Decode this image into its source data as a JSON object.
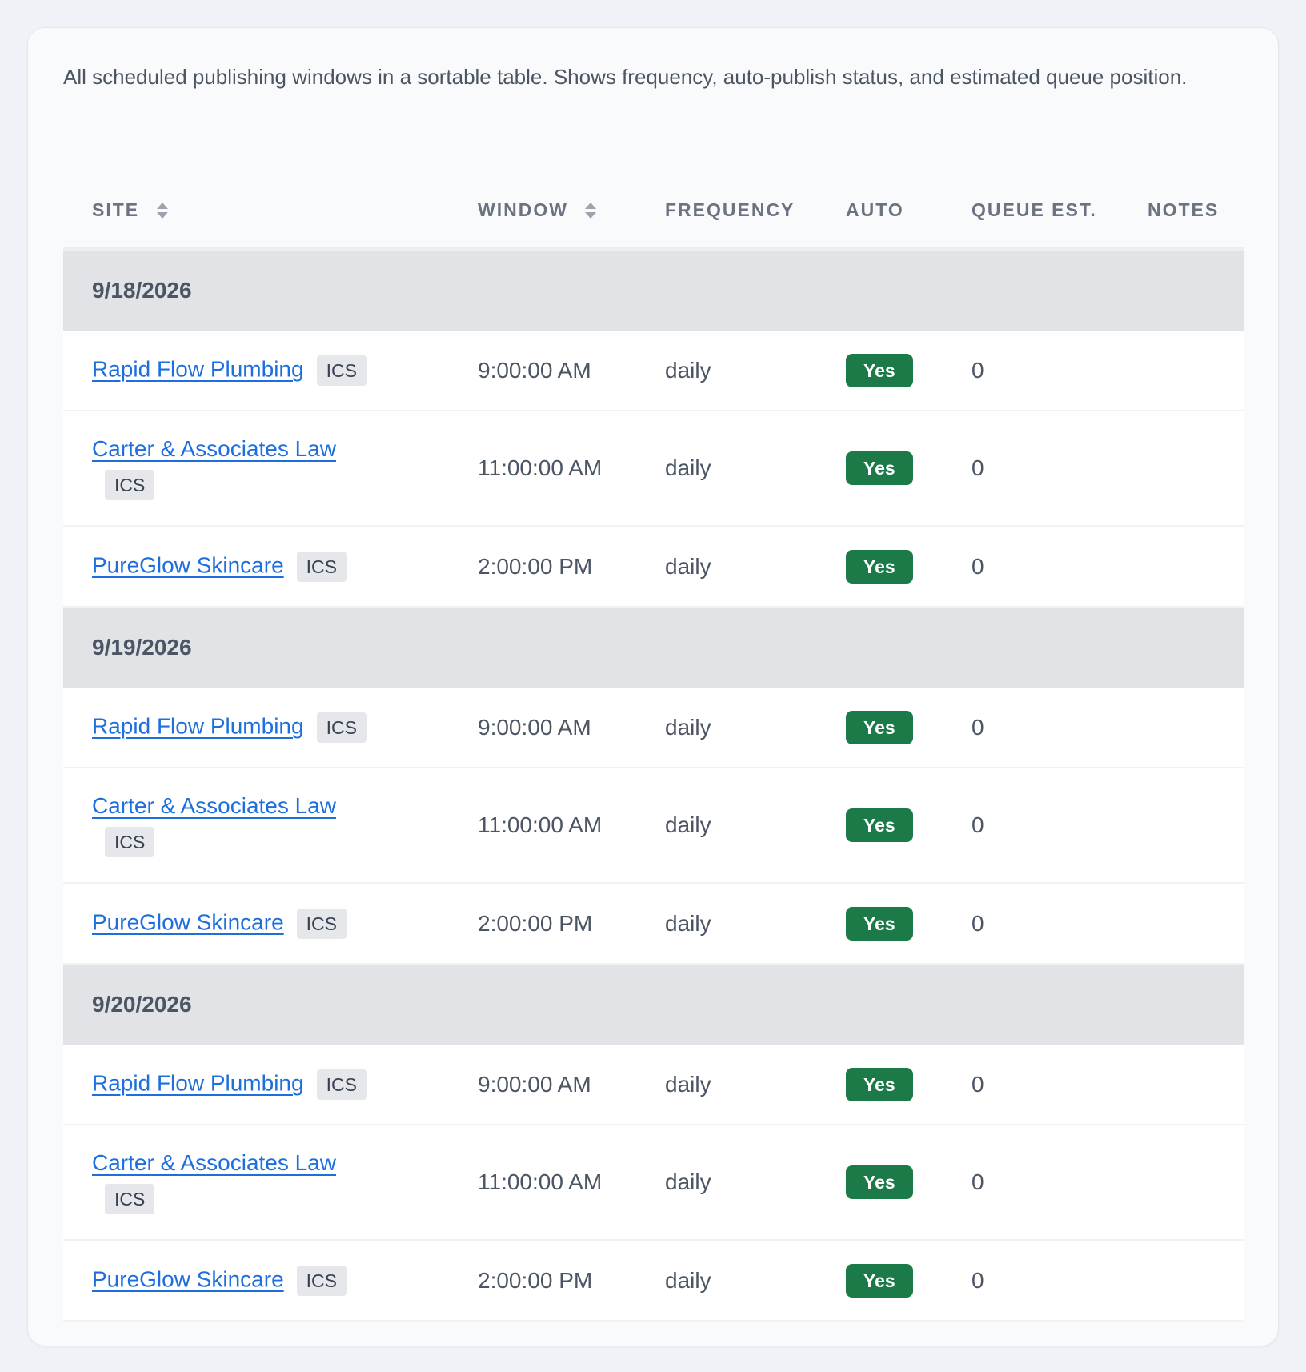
{
  "description": "All scheduled publishing windows in a sortable table. Shows frequency, auto-publish status, and estimated queue position.",
  "table": {
    "headers": {
      "site": "SITE",
      "window": "WINDOW",
      "frequency": "FREQUENCY",
      "auto": "AUTO",
      "queue": "QUEUE EST.",
      "notes": "NOTES"
    },
    "groups": [
      {
        "date": "9/18/2026",
        "rows": [
          {
            "site": "Rapid Flow Plumbing",
            "tag": "ICS",
            "window": "9:00:00 AM",
            "frequency": "daily",
            "auto": "Yes",
            "queue": "0",
            "notes": ""
          },
          {
            "site": "Carter & Associates Law",
            "tag": "ICS",
            "window": "11:00:00 AM",
            "frequency": "daily",
            "auto": "Yes",
            "queue": "0",
            "notes": ""
          },
          {
            "site": "PureGlow Skincare",
            "tag": "ICS",
            "window": "2:00:00 PM",
            "frequency": "daily",
            "auto": "Yes",
            "queue": "0",
            "notes": ""
          }
        ]
      },
      {
        "date": "9/19/2026",
        "rows": [
          {
            "site": "Rapid Flow Plumbing",
            "tag": "ICS",
            "window": "9:00:00 AM",
            "frequency": "daily",
            "auto": "Yes",
            "queue": "0",
            "notes": ""
          },
          {
            "site": "Carter & Associates Law",
            "tag": "ICS",
            "window": "11:00:00 AM",
            "frequency": "daily",
            "auto": "Yes",
            "queue": "0",
            "notes": ""
          },
          {
            "site": "PureGlow Skincare",
            "tag": "ICS",
            "window": "2:00:00 PM",
            "frequency": "daily",
            "auto": "Yes",
            "queue": "0",
            "notes": ""
          }
        ]
      },
      {
        "date": "9/20/2026",
        "rows": [
          {
            "site": "Rapid Flow Plumbing",
            "tag": "ICS",
            "window": "9:00:00 AM",
            "frequency": "daily",
            "auto": "Yes",
            "queue": "0",
            "notes": ""
          },
          {
            "site": "Carter & Associates Law",
            "tag": "ICS",
            "window": "11:00:00 AM",
            "frequency": "daily",
            "auto": "Yes",
            "queue": "0",
            "notes": ""
          },
          {
            "site": "PureGlow Skincare",
            "tag": "ICS",
            "window": "2:00:00 PM",
            "frequency": "daily",
            "auto": "Yes",
            "queue": "0",
            "notes": ""
          }
        ]
      }
    ]
  },
  "colors": {
    "link": "#1d6fde",
    "badge_yes": "#1b7a48",
    "group_band": "#e1e3e6",
    "chip_bg": "#e5e7eb"
  },
  "icons": {
    "sort": "sort-icon"
  }
}
